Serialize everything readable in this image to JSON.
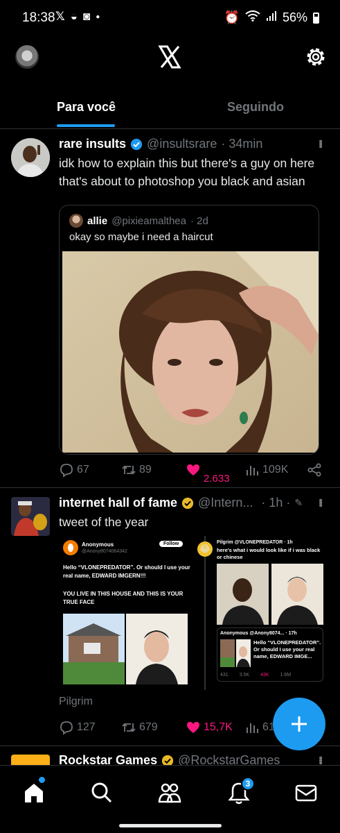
{
  "status_bar": {
    "time": "18:38",
    "battery": "56%"
  },
  "header": {
    "logo_icon": "x-logo-icon",
    "settings_icon": "gear-icon"
  },
  "tabs": [
    {
      "label": "Para você",
      "active": true
    },
    {
      "label": "Seguindo",
      "active": false
    }
  ],
  "tweets": [
    {
      "name": "rare insults",
      "handle": "@insultsrare",
      "time": "· 34min",
      "text_line1": "idk how to explain this but there's a guy on here",
      "text_line2": "that's about to photoshop you black and asian",
      "quote": {
        "name": "allie",
        "handle": "@pixieamalthea",
        "time": "· 2d",
        "text": "okay so maybe i need a haircut"
      },
      "replies": "67",
      "retweets": "89",
      "likes": "2.633",
      "views": "109K"
    },
    {
      "name": "internet hall of fame",
      "handle": "@Intern...",
      "time": "· 1h ·",
      "text": "tweet of the year",
      "embedded": {
        "left_name": "Anonymous",
        "left_handle": "@Anony8074064342",
        "follow_label": "Follow",
        "left_text1": "Hello “VLONEPREDATOR”. Or should I use your real name, EDWARD IMGERN!!!",
        "left_text2": "YOU LIVE IN THIS HOUSE AND THIS IS YOUR TRUE FACE",
        "right_name": "Pilgrim @VLONEPREDATOR · 1h",
        "right_text": "here's what i would look like if i was black or chinese",
        "inner_name": "Anonymous @Anony8074... · 17h",
        "inner_text": "Hello “VLONEPREDATOR”. Or should I use your real name, EDWARD IMGE...",
        "inner_stats": [
          "431",
          "3.5K",
          "43K",
          "1.6M"
        ]
      },
      "caption": "Pilgrim",
      "replies": "127",
      "retweets": "679",
      "likes": "15,7K",
      "views": "61"
    },
    {
      "name": "Rockstar Games",
      "handle": "@RockstarGames"
    }
  ],
  "notifications_badge": "3",
  "colors": {
    "accent": "#1d9bf0",
    "like": "#f91880",
    "muted": "#71767b",
    "verified_gold": "#e8b829"
  }
}
